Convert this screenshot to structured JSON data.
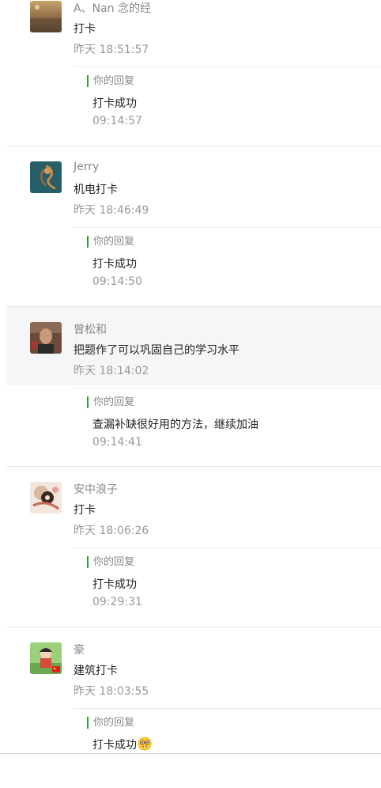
{
  "comments": [
    {
      "nickname": "A、Nan 念的经",
      "avatar": "beach-sunset-avatar",
      "content": "打卡",
      "time": "昨天 18:51:57",
      "reply": {
        "label": "你的回复",
        "text": "打卡成功",
        "time": "09:14:57"
      }
    },
    {
      "nickname": "Jerry",
      "avatar": "octopus-art-avatar",
      "content": "机电打卡",
      "time": "昨天 18:46:49",
      "reply": {
        "label": "你的回复",
        "text": "打卡成功",
        "time": "09:14:50"
      }
    },
    {
      "nickname": "曾松和",
      "avatar": "man-portrait-avatar",
      "content": "把题作了可以巩固自己的学习水平",
      "time": "昨天 18:14:02",
      "reply": {
        "label": "你的回复",
        "text": "查漏补缺很好用的方法，继续加油",
        "time": "09:14:41"
      }
    },
    {
      "nickname": "安中浪子",
      "avatar": "cartoon-girl-avatar",
      "content": "打卡",
      "time": "昨天 18:06:26",
      "reply": {
        "label": "你的回复",
        "text": "打卡成功",
        "time": "09:29:31"
      }
    },
    {
      "nickname": "豪",
      "avatar": "anime-character-avatar",
      "content": "建筑打卡",
      "time": "昨天 18:03:55",
      "reply": {
        "label": "你的回复",
        "text": "打卡成功",
        "time": "",
        "emoji": "nerd-face-emoji"
      }
    }
  ],
  "colors": {
    "reply_accent": "#1aad19",
    "highlight_bg": "#f5f6f8",
    "meta_text": "#999999",
    "nickname_text": "#888888",
    "body_text": "#222222"
  }
}
